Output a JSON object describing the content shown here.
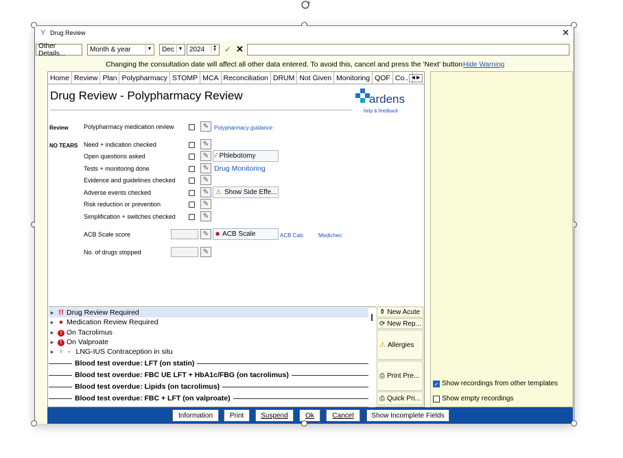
{
  "window": {
    "title": "Drug Review"
  },
  "toolbar": {
    "other_details": "Other Details...",
    "date_format": "Month & year",
    "month": "Dec",
    "year": "2024",
    "text_value": ""
  },
  "warning": {
    "text": "Changing the consultation date will affect all other data entered. To avoid this, cancel and press the 'Next' button",
    "link": "Hide Warning"
  },
  "tabs": [
    "Home",
    "Review",
    "Plan",
    "Polypharmacy",
    "STOMP",
    "MCA",
    "Reconciliation",
    "DRUM",
    "Not Given",
    "Monitoring",
    "QOF",
    "Co..."
  ],
  "active_tab": "Polypharmacy",
  "page": {
    "heading": "Drug Review - Polypharmacy Review"
  },
  "logo": {
    "name": "ardens",
    "tagline": "help & feedback"
  },
  "review": {
    "section": "Review",
    "label": "Polypharmacy medication review",
    "link": "Polypharmacy guidance"
  },
  "no_tears": {
    "section": "NO TEARS",
    "items": [
      "Need + indication checked",
      "Open questions asked",
      "Tests + monitoring done",
      "Evidence and guidelines checked",
      "Adverse events checked",
      "Risk reduction or prevention",
      "Simplification + switches checked"
    ],
    "phlebotomy": "Phlebotomy",
    "drug_monitoring": "Drug Monitoring",
    "side_effects": "Show Side Effe..."
  },
  "acb": {
    "label": "ACB Scale score",
    "button": "ACB Scale",
    "calc_link": "ACB Calc",
    "medichec_link": "Medichec"
  },
  "drugs_stopped": {
    "label": "No. of drugs stopped"
  },
  "alerts": [
    {
      "text": "Drug Review Required",
      "icon": "double-exclamation-icon"
    },
    {
      "text": "Medication Review Required",
      "icon": "pill-icon"
    },
    {
      "text": "On Tacrolimus",
      "icon": "red-exclamation-icon"
    },
    {
      "text": "On Valproate",
      "icon": "red-exclamation-icon"
    },
    {
      "text": "LNG-IUS Contraception in situ",
      "icon": "bulb-icon",
      "prefix": "-"
    }
  ],
  "overdue": [
    "Blood test overdue: LFT (on statin)",
    "Blood test overdue: FBC UE LFT + HbA1c/FBG (on tacrolimus)",
    "Blood test overdue: Lipids (on tacrolimus)",
    "Blood test overdue: FBC + LFT (on valproate)"
  ],
  "side_buttons": {
    "new_acute": "New Acute",
    "new_repeat": "New Rep...",
    "allergies": "Allergies",
    "print_pre": "Print Pre...",
    "quick_pri": "Quick Pri..."
  },
  "options": {
    "show_other_templates": "Show recordings from other templates",
    "show_empty": "Show empty recordings"
  },
  "footer": {
    "information": "Information",
    "print": "Print",
    "suspend": "Suspend",
    "ok": "Ok",
    "cancel": "Cancel",
    "show_incomplete": "Show Incomplete Fields"
  },
  "colors": {
    "footer_bg": "#0f4ea3",
    "link": "#1a56b8",
    "panel_bg": "#fbfbe6"
  }
}
